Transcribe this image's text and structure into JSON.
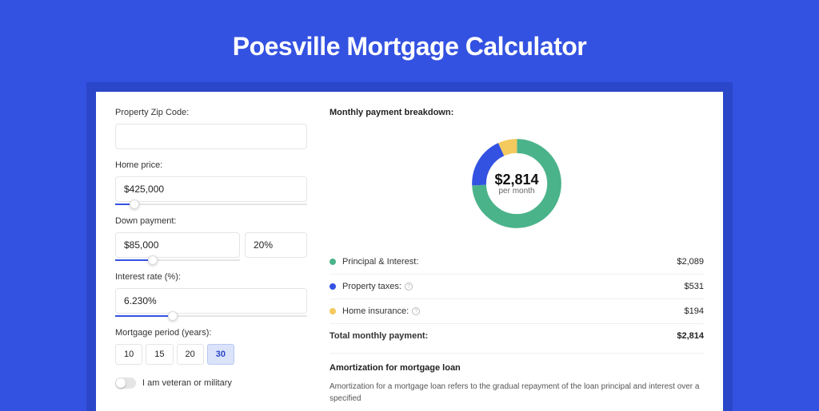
{
  "title": "Poesville Mortgage Calculator",
  "form": {
    "zip": {
      "label": "Property Zip Code:",
      "value": ""
    },
    "home_price": {
      "label": "Home price:",
      "value": "$425,000",
      "slider_pct": 10
    },
    "down_payment": {
      "label": "Down payment:",
      "value": "$85,000",
      "pct_value": "20%",
      "slider_pct": 30
    },
    "interest": {
      "label": "Interest rate (%):",
      "value": "6.230%",
      "slider_pct": 30
    },
    "period": {
      "label": "Mortgage period (years):",
      "options": [
        "10",
        "15",
        "20",
        "30"
      ],
      "selected": "30"
    },
    "veteran": {
      "label": "I am veteran or military",
      "on": false
    }
  },
  "breakdown": {
    "header": "Monthly payment breakdown:",
    "center_value": "$2,814",
    "center_sub": "per month",
    "items": [
      {
        "label": "Principal & Interest:",
        "value": "$2,089",
        "color": "#4bb38a",
        "info": false
      },
      {
        "label": "Property taxes:",
        "value": "$531",
        "color": "#3452e1",
        "info": true
      },
      {
        "label": "Home insurance:",
        "value": "$194",
        "color": "#f4c95d",
        "info": true
      }
    ],
    "total": {
      "label": "Total monthly payment:",
      "value": "$2,814"
    }
  },
  "amortization": {
    "heading": "Amortization for mortgage loan",
    "body": "Amortization for a mortgage loan refers to the gradual repayment of the loan principal and interest over a specified"
  },
  "chart_data": {
    "type": "pie",
    "title": "Monthly payment breakdown",
    "series": [
      {
        "name": "Principal & Interest",
        "value": 2089,
        "color": "#4bb38a"
      },
      {
        "name": "Property taxes",
        "value": 531,
        "color": "#3452e1"
      },
      {
        "name": "Home insurance",
        "value": 194,
        "color": "#f4c95d"
      }
    ],
    "total": 2814,
    "center_label": "$2,814 per month"
  }
}
